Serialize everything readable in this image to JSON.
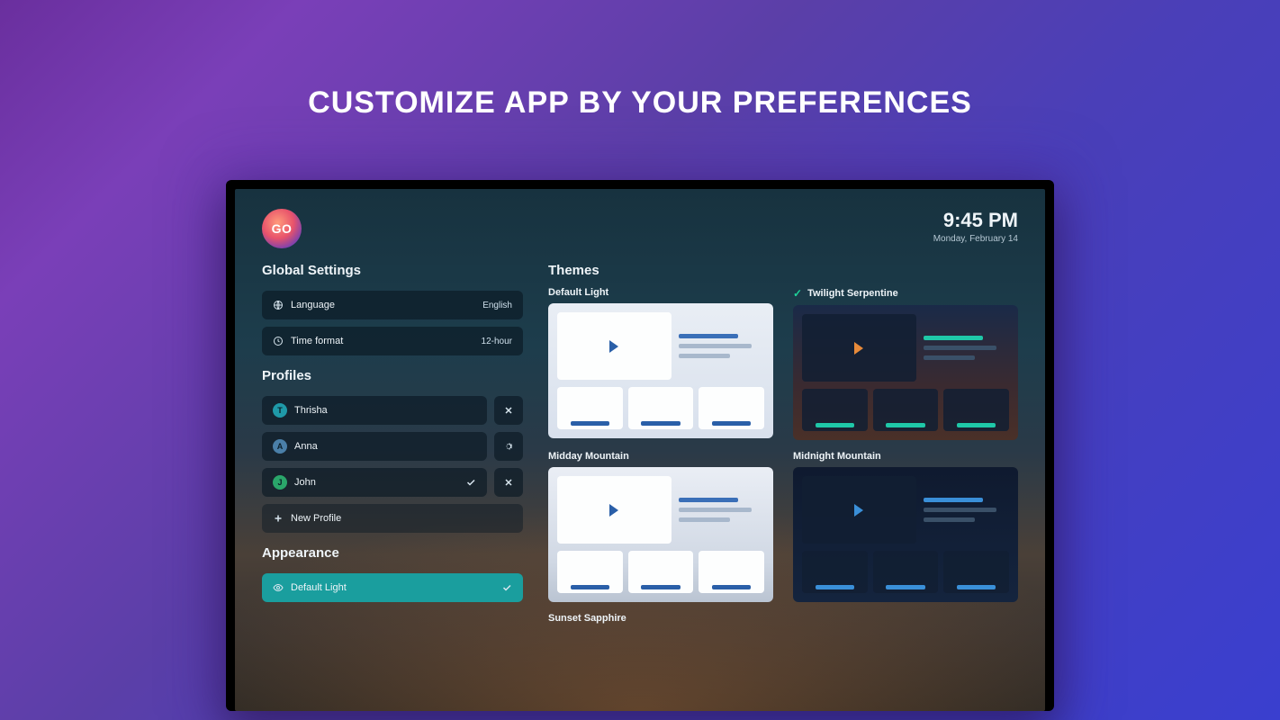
{
  "page_title": "CUSTOMIZE APP BY YOUR PREFERENCES",
  "logo_text": "GO",
  "clock": {
    "time": "9:45 PM",
    "date": "Monday, February 14"
  },
  "sections": {
    "global": {
      "title": "Global Settings",
      "language": {
        "label": "Language",
        "value": "English"
      },
      "time_format": {
        "label": "Time format",
        "value": "12-hour"
      }
    },
    "profiles": {
      "title": "Profiles",
      "items": [
        {
          "initial": "T",
          "name": "Thrisha",
          "active": false
        },
        {
          "initial": "A",
          "name": "Anna",
          "active": false
        },
        {
          "initial": "J",
          "name": "John",
          "active": true
        }
      ],
      "new_label": "New Profile"
    },
    "appearance": {
      "title": "Appearance",
      "selected_label": "Default Light"
    },
    "themes": {
      "title": "Themes",
      "items": [
        {
          "name": "Default Light",
          "variant": "tc-light",
          "checked": false
        },
        {
          "name": "Twilight Serpentine",
          "variant": "tc-twilight",
          "checked": true
        },
        {
          "name": "Midday Mountain",
          "variant": "tc-midday",
          "checked": false
        },
        {
          "name": "Midnight Mountain",
          "variant": "tc-midnight",
          "checked": false
        }
      ],
      "extra_label": "Sunset Sapphire"
    }
  },
  "icons": {
    "globe": "globe-icon",
    "clock": "clock-icon",
    "gear": "gear-icon",
    "close": "close-icon",
    "check": "check-icon",
    "plus": "plus-icon",
    "eye": "eye-icon"
  }
}
